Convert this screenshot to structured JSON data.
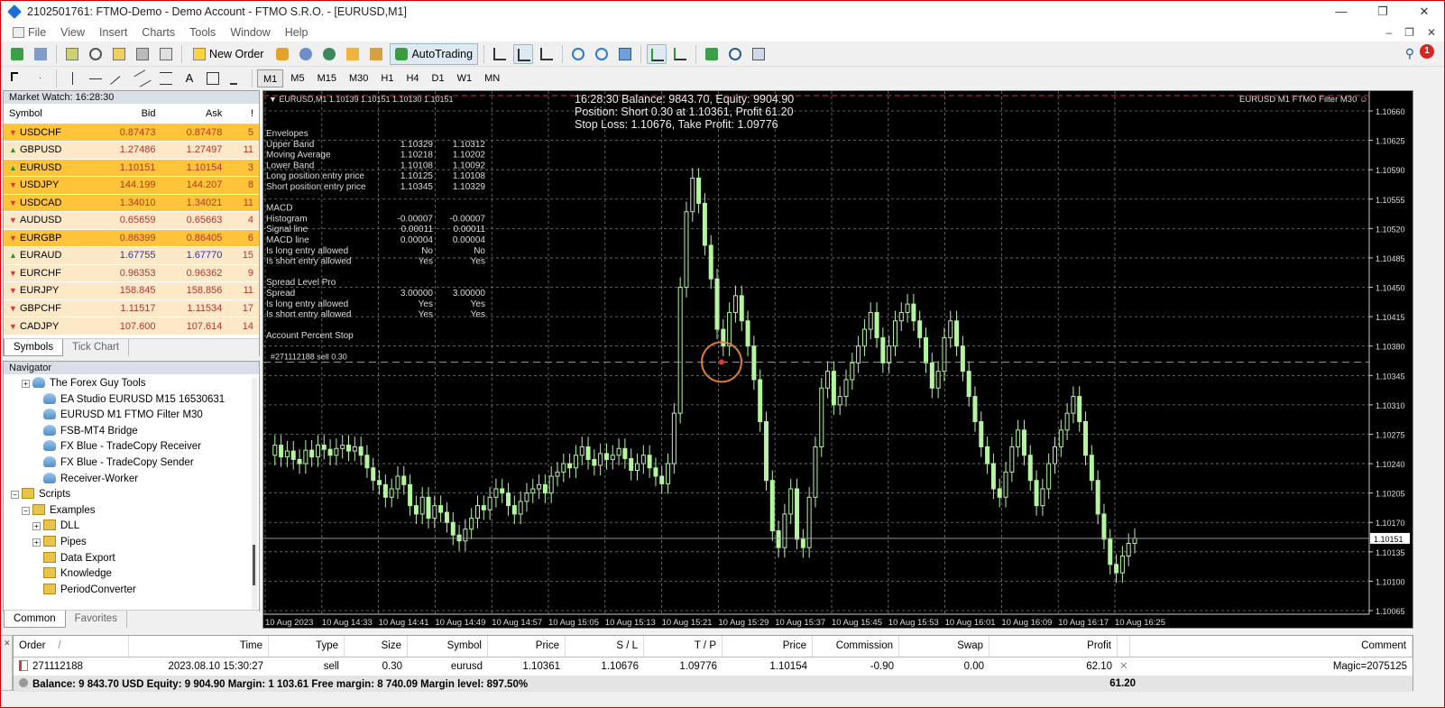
{
  "window": {
    "title": "2102501761: FTMO-Demo - Demo Account - FTMO S.R.O. - [EURUSD,M1]",
    "controls": [
      "—",
      "❐",
      "✕"
    ]
  },
  "menu": {
    "items": [
      "File",
      "View",
      "Insert",
      "Charts",
      "Tools",
      "Window",
      "Help"
    ],
    "right_controls": [
      "–",
      "❐",
      "✕"
    ]
  },
  "toolbar": {
    "new_order": "New Order",
    "autotrading": "AutoTrading",
    "timeframes": [
      "M1",
      "M5",
      "M15",
      "M30",
      "H1",
      "H4",
      "D1",
      "W1",
      "MN"
    ],
    "selected_timeframe": "M1",
    "notification_count": "1"
  },
  "market_watch": {
    "title": "Market Watch: 16:28:30",
    "columns": {
      "symbol": "Symbol",
      "bid": "Bid",
      "ask": "Ask",
      "spread": "!"
    },
    "rows": [
      {
        "symbol": "USDCHF",
        "bid": "0.87473",
        "ask": "0.87478",
        "spread": "5",
        "dir": "down",
        "style": "hl"
      },
      {
        "symbol": "GBPUSD",
        "bid": "1.27486",
        "ask": "1.27497",
        "spread": "11",
        "dir": "up",
        "style": "lt"
      },
      {
        "symbol": "EURUSD",
        "bid": "1.10151",
        "ask": "1.10154",
        "spread": "3",
        "dir": "up",
        "style": "hl"
      },
      {
        "symbol": "USDJPY",
        "bid": "144.199",
        "ask": "144.207",
        "spread": "8",
        "dir": "down",
        "style": "hl"
      },
      {
        "symbol": "USDCAD",
        "bid": "1.34010",
        "ask": "1.34021",
        "spread": "11",
        "dir": "down",
        "style": "hl"
      },
      {
        "symbol": "AUDUSD",
        "bid": "0.65659",
        "ask": "0.65663",
        "spread": "4",
        "dir": "down",
        "style": "lt"
      },
      {
        "symbol": "EURGBP",
        "bid": "0.86399",
        "ask": "0.86405",
        "spread": "6",
        "dir": "down",
        "style": "hl"
      },
      {
        "symbol": "EURAUD",
        "bid": "1.67755",
        "ask": "1.67770",
        "spread": "15",
        "dir": "up",
        "style": "lt",
        "blue": true
      },
      {
        "symbol": "EURCHF",
        "bid": "0.96353",
        "ask": "0.96362",
        "spread": "9",
        "dir": "down",
        "style": "lt"
      },
      {
        "symbol": "EURJPY",
        "bid": "158.845",
        "ask": "158.856",
        "spread": "11",
        "dir": "down",
        "style": "lt"
      },
      {
        "symbol": "GBPCHF",
        "bid": "1.11517",
        "ask": "1.11534",
        "spread": "17",
        "dir": "down",
        "style": "lt"
      },
      {
        "symbol": "CADJPY",
        "bid": "107.600",
        "ask": "107.614",
        "spread": "14",
        "dir": "down",
        "style": "lt"
      }
    ],
    "tabs": [
      "Symbols",
      "Tick Chart"
    ]
  },
  "navigator": {
    "title": "Navigator",
    "items": [
      {
        "label": "The Forex Guy Tools",
        "indent": 2,
        "icon": "ea",
        "exp": "+"
      },
      {
        "label": "EA Studio EURUSD M15 16530631",
        "indent": 3,
        "icon": "ea"
      },
      {
        "label": "EURUSD M1 FTMO Filter M30",
        "indent": 3,
        "icon": "ea"
      },
      {
        "label": "FSB-MT4 Bridge",
        "indent": 3,
        "icon": "ea"
      },
      {
        "label": "FX Blue - TradeCopy Receiver",
        "indent": 3,
        "icon": "ea"
      },
      {
        "label": "FX Blue - TradeCopy Sender",
        "indent": 3,
        "icon": "ea"
      },
      {
        "label": "Receiver-Worker",
        "indent": 3,
        "icon": "ea"
      },
      {
        "label": "Scripts",
        "indent": 1,
        "icon": "folder",
        "exp": "−"
      },
      {
        "label": "Examples",
        "indent": 2,
        "icon": "folder",
        "exp": "−"
      },
      {
        "label": "DLL",
        "indent": 3,
        "icon": "folder",
        "exp": "+"
      },
      {
        "label": "Pipes",
        "indent": 3,
        "icon": "folder",
        "exp": "+"
      },
      {
        "label": "Data Export",
        "indent": 3,
        "icon": "folder"
      },
      {
        "label": "Knowledge",
        "indent": 3,
        "icon": "folder"
      },
      {
        "label": "PeriodConverter",
        "indent": 3,
        "icon": "folder"
      }
    ],
    "tabs": [
      "Common",
      "Favorites"
    ]
  },
  "chart": {
    "symbol_info": "EURUSD,M1  1.10139 1.10151 1.10130 1.10151",
    "ea_label": "EURUSD M1 FTMO Filter M30",
    "info_lines": [
      "16:28:30 Balance: 9843.70, Equity: 9904.90",
      "Position: Short 0.30 at 1.10361, Profit 61.20",
      "Stop Loss: 1.10676, Take Profit: 1.09776"
    ],
    "indicator_rows": [
      {
        "label": "Envelopes",
        "v1": "",
        "v2": ""
      },
      {
        "label": "Upper Band",
        "v1": "1.10329",
        "v2": "1.10312"
      },
      {
        "label": "Moving Average",
        "v1": "1.10218",
        "v2": "1.10202"
      },
      {
        "label": "Lower Band",
        "v1": "1.10108",
        "v2": "1.10092"
      },
      {
        "label": "Long position entry price",
        "v1": "1.10125",
        "v2": "1.10108"
      },
      {
        "label": "Short position entry price",
        "v1": "1.10345",
        "v2": "1.10329"
      },
      {
        "label": "",
        "v1": "",
        "v2": ""
      },
      {
        "label": "MACD",
        "v1": "",
        "v2": ""
      },
      {
        "label": "Histogram",
        "v1": "-0.00007",
        "v2": "-0.00007"
      },
      {
        "label": "Signal line",
        "v1": "0.00011",
        "v2": "0.00011"
      },
      {
        "label": "MACD line",
        "v1": "0.00004",
        "v2": "0.00004"
      },
      {
        "label": "Is long entry allowed",
        "v1": "No",
        "v2": "No"
      },
      {
        "label": "Is short entry allowed",
        "v1": "Yes",
        "v2": "Yes"
      },
      {
        "label": "",
        "v1": "",
        "v2": ""
      },
      {
        "label": "Spread Level Pro",
        "v1": "",
        "v2": ""
      },
      {
        "label": "Spread",
        "v1": "3.00000",
        "v2": "3.00000"
      },
      {
        "label": "Is long entry allowed",
        "v1": "Yes",
        "v2": "Yes"
      },
      {
        "label": "Is short entry allowed",
        "v1": "Yes",
        "v2": "Yes"
      },
      {
        "label": "",
        "v1": "",
        "v2": ""
      },
      {
        "label": "Account Percent Stop",
        "v1": "",
        "v2": ""
      }
    ],
    "order_label": "#271112188 sell 0.30",
    "price_axis": [
      "1.10660",
      "1.10625",
      "1.10590",
      "1.10555",
      "1.10520",
      "1.10485",
      "1.10450",
      "1.10415",
      "1.10380",
      "1.10345",
      "1.10310",
      "1.10275",
      "1.10240",
      "1.10205",
      "1.10170",
      "1.10135",
      "1.10100",
      "1.10065"
    ],
    "current_price": "1.10151",
    "time_axis": [
      "10 Aug 2023",
      "10 Aug 14:33",
      "10 Aug 14:41",
      "10 Aug 14:49",
      "10 Aug 14:57",
      "10 Aug 15:05",
      "10 Aug 15:13",
      "10 Aug 15:21",
      "10 Aug 15:29",
      "10 Aug 15:37",
      "10 Aug 15:45",
      "10 Aug 15:53",
      "10 Aug 16:01",
      "10 Aug 16:09",
      "10 Aug 16:17",
      "10 Aug 16:25"
    ],
    "colors": {
      "background": "#000000",
      "candle": "#b4f5a0",
      "grid": "#7a7a7a",
      "text": "#ffffff",
      "marker": "#e07b30"
    }
  },
  "terminal": {
    "columns": [
      "Order",
      "/",
      "Time",
      "Type",
      "Size",
      "Symbol",
      "Price",
      "S / L",
      "T / P",
      "Price",
      "Commission",
      "Swap",
      "Profit",
      "",
      "Comment"
    ],
    "order": {
      "id": "271112188",
      "time": "2023.08.10 15:30:27",
      "type": "sell",
      "size": "0.30",
      "symbol": "eurusd",
      "price": "1.10361",
      "sl": "1.10676",
      "tp": "1.09776",
      "cur_price": "1.10154",
      "commission": "-0.90",
      "swap": "0.00",
      "profit": "62.10",
      "close": "✕",
      "comment": "Magic=2075125"
    },
    "balance_line": "Balance: 9 843.70 USD  Equity: 9 904.90  Margin: 1 103.61  Free margin: 8 740.09  Margin level: 897.50%",
    "total_profit": "61.20"
  }
}
